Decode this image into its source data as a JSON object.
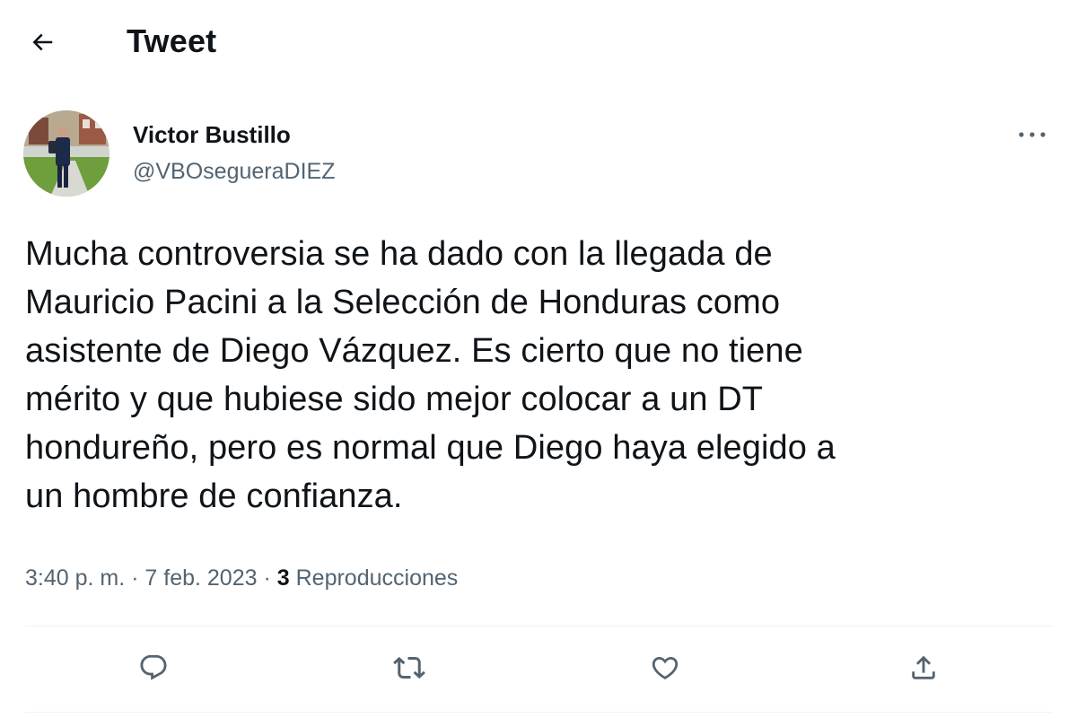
{
  "header": {
    "title": "Tweet",
    "back_icon": "arrow-left-icon"
  },
  "author": {
    "display_name": "Victor Bustillo",
    "handle": "@VBOsegueraDIEZ",
    "avatar_icon": "profile-photo"
  },
  "tweet": {
    "text": "Mucha controversia se ha dado con la llegada de\nMauricio Pacini a la Selección de Honduras como\nasistente de Diego Vázquez. Es cierto que no tiene\nmérito y que hubiese sido mejor colocar a un DT\nhondureño, pero es normal que Diego haya elegido a\nun hombre de confianza.",
    "time": "3:40 p. m.",
    "separator": "·",
    "date": "7 feb. 2023",
    "views_count": "3",
    "views_label": "Reproducciones"
  },
  "actions": {
    "reply_icon": "reply-icon",
    "retweet_icon": "retweet-icon",
    "like_icon": "heart-icon",
    "share_icon": "share-icon",
    "more_icon": "more-dots-icon"
  },
  "colors": {
    "text_primary": "#0f1419",
    "text_secondary": "#536471",
    "divider": "#eff3f4",
    "background": "#ffffff"
  }
}
